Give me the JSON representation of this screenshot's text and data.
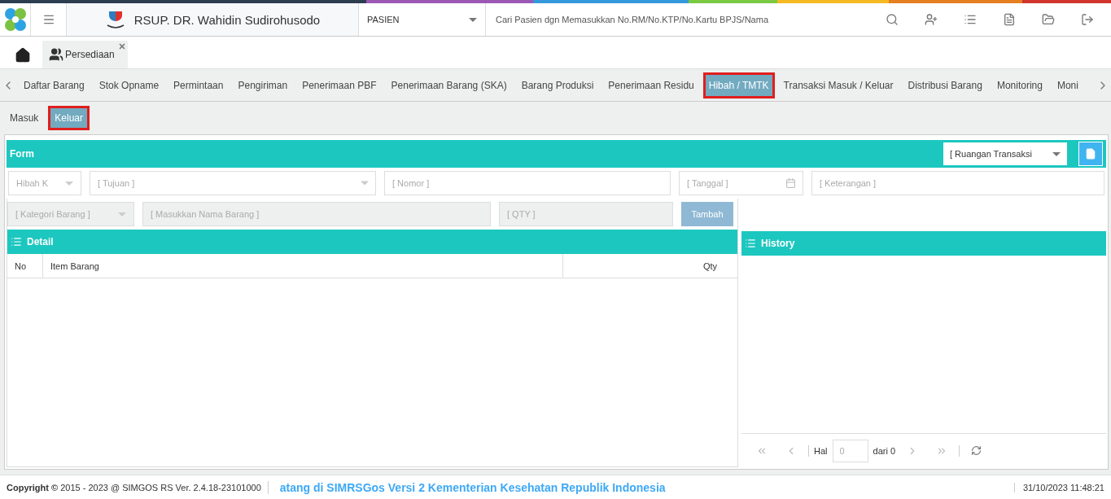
{
  "header": {
    "hospital": "RSUP. DR. Wahidin Sudirohusodo",
    "patient_select": "PASIEN",
    "search": {
      "placeholder": "Cari Pasien dgn Memasukkan No.RM/No.KTP/No.Kartu BPJS/Nama"
    }
  },
  "open_tabs": [
    {
      "label": "Persediaan",
      "selected": true
    }
  ],
  "nav_tabs": [
    {
      "label": "Daftar Barang",
      "selected": false
    },
    {
      "label": "Stok Opname",
      "selected": false
    },
    {
      "label": "Permintaan",
      "selected": false
    },
    {
      "label": "Pengiriman",
      "selected": false
    },
    {
      "label": "Penerimaan PBF",
      "selected": false
    },
    {
      "label": "Penerimaan Barang (SKA)",
      "selected": false
    },
    {
      "label": "Barang Produksi",
      "selected": false
    },
    {
      "label": "Penerimaan Residu",
      "selected": false
    },
    {
      "label": "Hibah / TMTK",
      "selected": true
    },
    {
      "label": "Transaksi Masuk / Keluar",
      "selected": false
    },
    {
      "label": "Distribusi Barang",
      "selected": false
    },
    {
      "label": "Monitoring",
      "selected": false
    },
    {
      "label": "Moni",
      "selected": false
    }
  ],
  "sub_tabs": [
    {
      "label": "Masuk",
      "selected": false
    },
    {
      "label": "Keluar",
      "selected": true
    }
  ],
  "form": {
    "title": "Form",
    "room_select": "[ Ruangan Transaksi",
    "type_select": "Hibah K",
    "tujuan": {
      "placeholder": "[ Tujuan ]"
    },
    "nomor": {
      "placeholder": "[ Nomor ]"
    },
    "tanggal": {
      "placeholder": "[ Tanggal ]"
    },
    "keterangan": {
      "placeholder": "[ Keterangan ]"
    }
  },
  "item_entry": {
    "kategori": "[ Kategori Barang ]",
    "nama": {
      "placeholder": "[ Masukkan Nama Barang ]"
    },
    "qty": {
      "placeholder": "[ QTY ]"
    },
    "button": "Tambah"
  },
  "detail": {
    "title": "Detail",
    "columns": [
      "No",
      "Item Barang",
      "Qty"
    ]
  },
  "history": {
    "title": "History",
    "pager": {
      "page_label": "Hal",
      "page_value": "0",
      "total": "dari 0"
    }
  },
  "footer": {
    "copyright": "**Copyright ©** 2015 - 2023 @ SIMGOS RS Ver. 2.4.18-23101000",
    "marquee": "atang di SIMRSGos Versi 2 Kementerian Kesehatan Republik Indonesia",
    "datetime": "31/10/2023 11:48:21"
  }
}
